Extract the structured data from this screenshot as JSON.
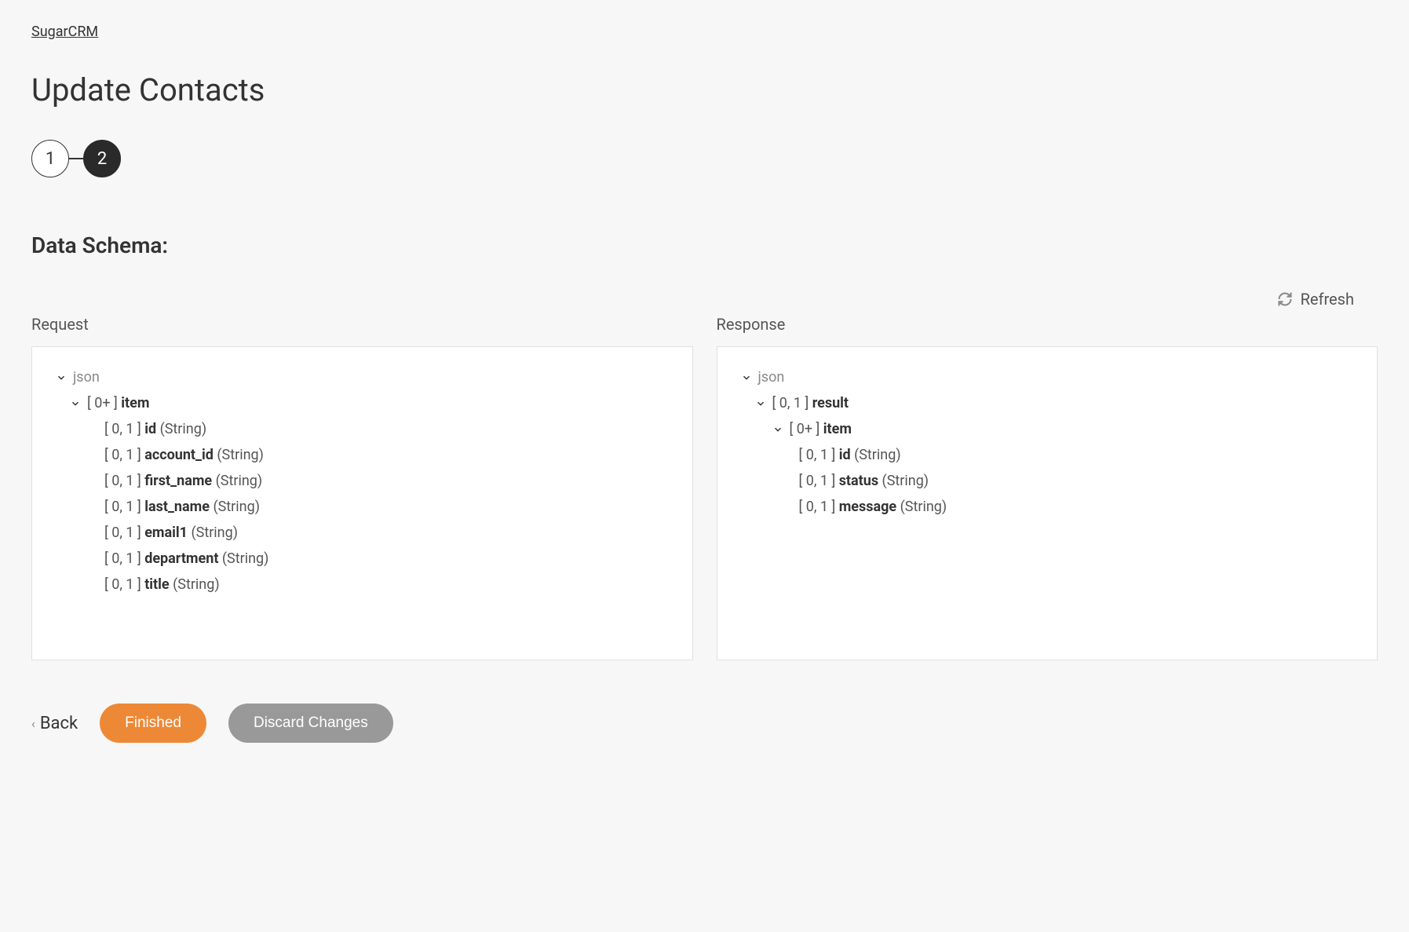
{
  "breadcrumb": {
    "label": "SugarCRM"
  },
  "page": {
    "title": "Update Contacts"
  },
  "stepper": {
    "step1": "1",
    "step2": "2"
  },
  "section": {
    "title": "Data Schema:"
  },
  "refresh": {
    "label": "Refresh"
  },
  "request": {
    "header": "Request",
    "root": "json",
    "item_card": "[ 0+ ]",
    "item_name": "item",
    "fields": [
      {
        "card": "[ 0, 1 ]",
        "name": "id",
        "type": "(String)"
      },
      {
        "card": "[ 0, 1 ]",
        "name": "account_id",
        "type": "(String)"
      },
      {
        "card": "[ 0, 1 ]",
        "name": "first_name",
        "type": "(String)"
      },
      {
        "card": "[ 0, 1 ]",
        "name": "last_name",
        "type": "(String)"
      },
      {
        "card": "[ 0, 1 ]",
        "name": "email1",
        "type": "(String)"
      },
      {
        "card": "[ 0, 1 ]",
        "name": "department",
        "type": "(String)"
      },
      {
        "card": "[ 0, 1 ]",
        "name": "title",
        "type": "(String)"
      }
    ]
  },
  "response": {
    "header": "Response",
    "root": "json",
    "result_card": "[ 0, 1 ]",
    "result_name": "result",
    "item_card": "[ 0+ ]",
    "item_name": "item",
    "fields": [
      {
        "card": "[ 0, 1 ]",
        "name": "id",
        "type": "(String)"
      },
      {
        "card": "[ 0, 1 ]",
        "name": "status",
        "type": "(String)"
      },
      {
        "card": "[ 0, 1 ]",
        "name": "message",
        "type": "(String)"
      }
    ]
  },
  "footer": {
    "back": "Back",
    "finished": "Finished",
    "discard": "Discard Changes"
  }
}
